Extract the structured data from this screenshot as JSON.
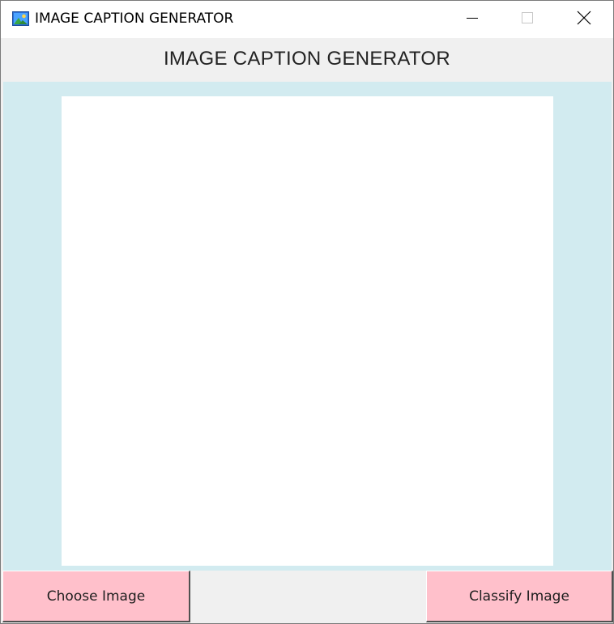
{
  "window": {
    "title": "IMAGE CAPTION GENERATOR",
    "icon": "photo-app-icon",
    "controls": {
      "minimize_icon": "minimize-icon",
      "maximize_icon": "maximize-icon",
      "close_icon": "close-icon"
    }
  },
  "header": {
    "title": "IMAGE CAPTION GENERATOR"
  },
  "main": {
    "panel_color": "#d2ebf0",
    "canvas_color": "#ffffff"
  },
  "actions": {
    "choose_label": "Choose Image",
    "classify_label": "Classify Image",
    "button_color": "#ffc0cb"
  }
}
